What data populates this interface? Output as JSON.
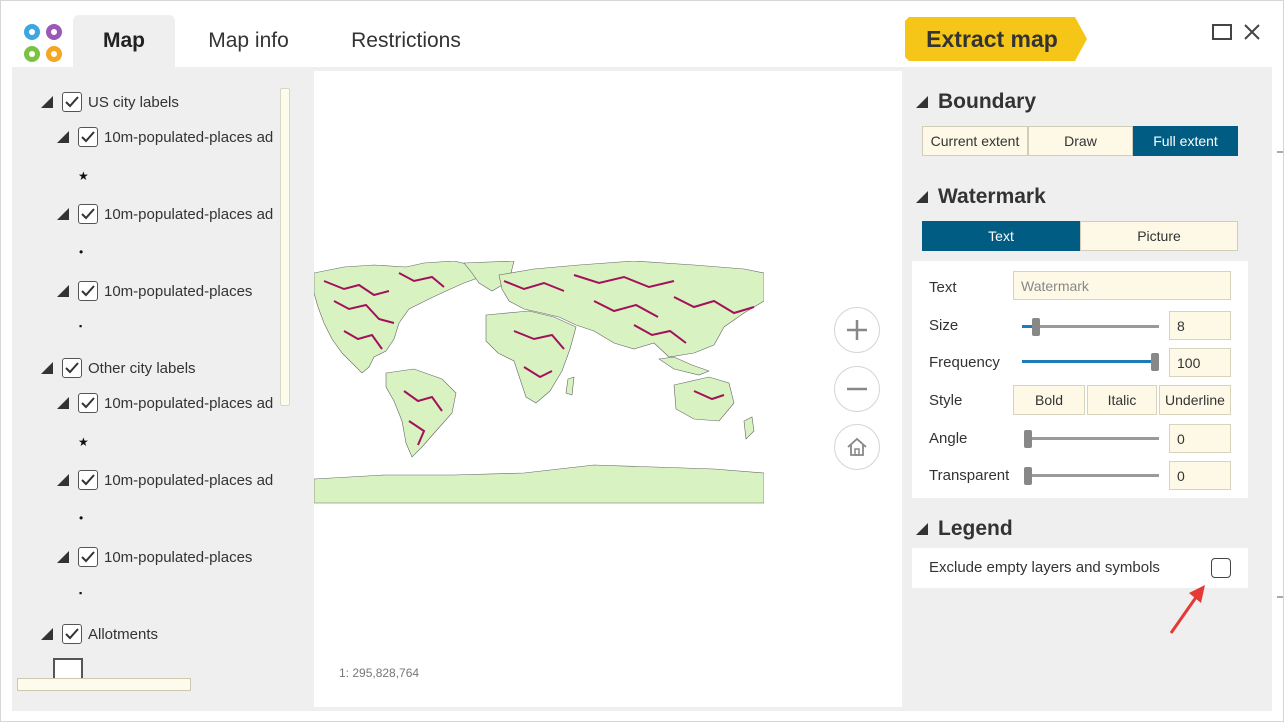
{
  "tabs": [
    {
      "label": "Map",
      "active": true
    },
    {
      "label": "Map info",
      "active": false
    },
    {
      "label": "Restrictions",
      "active": false
    }
  ],
  "extract_button": "Extract map",
  "colors": {
    "accent": "#005c82",
    "extract": "#f5c518",
    "land": "#d9f2c2",
    "rivers": "#a3115a",
    "field_bg": "#fdf9e6"
  },
  "layer_tree": [
    {
      "label": "US city labels",
      "level": 0,
      "checked": true
    },
    {
      "label": "10m-populated-places ad",
      "level": 1,
      "checked": true,
      "symbol": "★"
    },
    {
      "label": "10m-populated-places ad",
      "level": 1,
      "checked": true,
      "symbol": "•"
    },
    {
      "label": "10m-populated-places",
      "level": 1,
      "checked": true,
      "symbol": "▪"
    },
    {
      "label": "Other city labels",
      "level": 0,
      "checked": true
    },
    {
      "label": "10m-populated-places ad",
      "level": 1,
      "checked": true,
      "symbol": "★"
    },
    {
      "label": "10m-populated-places ad",
      "level": 1,
      "checked": true,
      "symbol": "•"
    },
    {
      "label": "10m-populated-places",
      "level": 1,
      "checked": true,
      "symbol": "▪"
    },
    {
      "label": "Allotments",
      "level": 0,
      "checked": true
    }
  ],
  "map": {
    "scale": "1: 295,828,764",
    "controls": [
      "zoom-in-icon",
      "zoom-out-icon",
      "home-icon"
    ]
  },
  "boundary": {
    "title": "Boundary",
    "options": [
      "Current extent",
      "Draw",
      "Full extent"
    ],
    "selected": "Full extent"
  },
  "watermark": {
    "title": "Watermark",
    "modes": [
      "Text",
      "Picture"
    ],
    "selected_mode": "Text",
    "text_label": "Text",
    "text_placeholder": "Watermark",
    "size_label": "Size",
    "size_value": "8",
    "frequency_label": "Frequency",
    "frequency_value": "100",
    "style_label": "Style",
    "style_options": [
      "Bold",
      "Italic",
      "Underline"
    ],
    "angle_label": "Angle",
    "angle_value": "0",
    "transparent_label": "Transparent",
    "transparent_value": "0"
  },
  "legend": {
    "title": "Legend",
    "exclude_label": "Exclude empty layers and symbols",
    "exclude_checked": false
  }
}
